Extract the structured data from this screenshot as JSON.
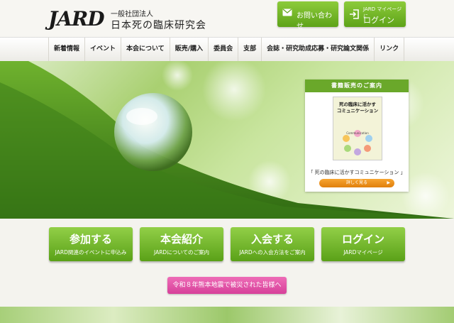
{
  "header": {
    "logo_mark": "JARD",
    "logo_sub": "一般社団法人",
    "logo_name": "日本死の臨床研究会",
    "contact_label": "お問い合わせ",
    "login_sub": "JARD マイページに",
    "login_label": "ログイン"
  },
  "nav": {
    "items": [
      "新着情報",
      "イベント",
      "本会について",
      "販売/購入",
      "委員会",
      "支部",
      "会誌・研究助成応募・研究論文関係",
      "リンク"
    ]
  },
  "book": {
    "heading": "書籍販売のご案内",
    "cover_title": "死の臨床に活かす\nコミュニケーション",
    "cover_subtitle": "Communication",
    "caption": "「 死の臨床に活かすコミュニケーション 」",
    "more_label": "詳しく見る"
  },
  "features": [
    {
      "title": "参加する",
      "sub": "JARD関連のイベントに申込み"
    },
    {
      "title": "本会紹介",
      "sub": "JARDについてのご案内"
    },
    {
      "title": "入会する",
      "sub": "JARDへの入会方法をご案内"
    },
    {
      "title": "ログイン",
      "sub": "JARDマイページ"
    }
  ],
  "notice": {
    "label": "令和８年熊本地震で被災された皆様へ"
  },
  "colors": {
    "brand_green": "#6aa82a",
    "notice_pink": "#e254a8",
    "accent_orange": "#f39a1f"
  }
}
